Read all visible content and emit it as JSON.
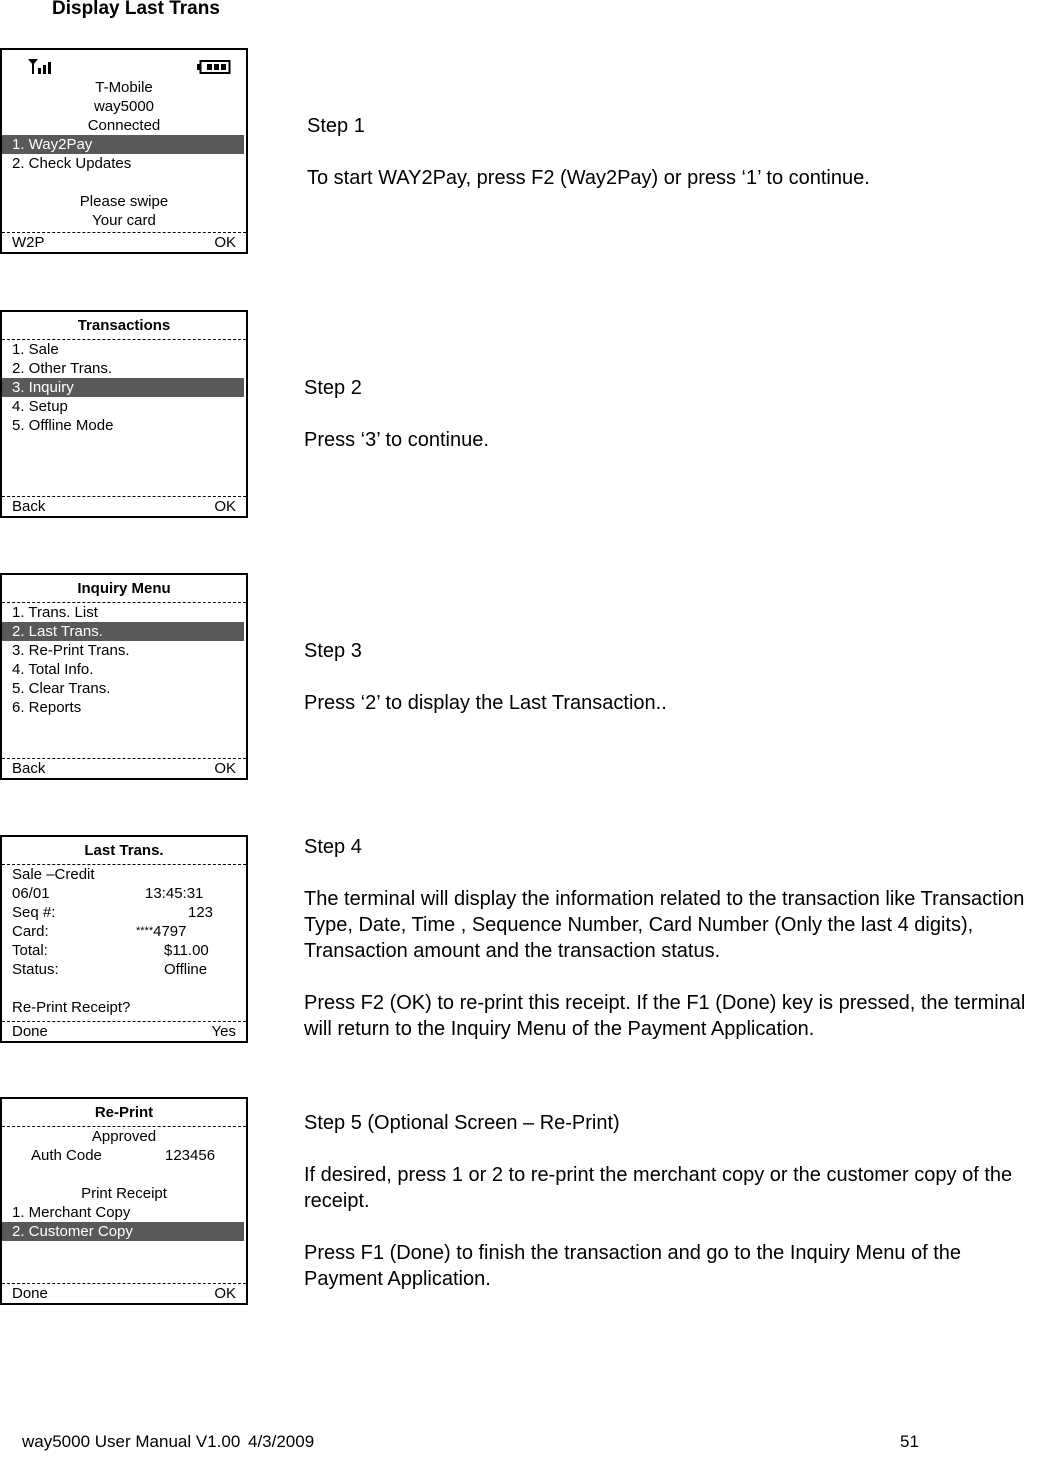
{
  "page_title": "Display Last Trans",
  "screens": {
    "s1": {
      "signal_icon": "signal-antenna-icon",
      "battery_icon": "battery-icon",
      "lines": [
        "T-Mobile",
        "way5000",
        "Connected"
      ],
      "menu": [
        "1. Way2Pay",
        "2. Check Updates"
      ],
      "selected_index": 0,
      "message": [
        "Please swipe",
        "Your card"
      ],
      "soft_left": "W2P",
      "soft_right": "OK"
    },
    "s2": {
      "header": "Transactions",
      "menu": [
        "1. Sale",
        "2. Other Trans.",
        "3. Inquiry",
        "4. Setup",
        "5. Offline Mode"
      ],
      "selected_index": 2,
      "soft_left": "Back",
      "soft_right": "OK"
    },
    "s3": {
      "header": "Inquiry Menu",
      "menu": [
        "1. Trans. List",
        "2. Last Trans.",
        "3. Re-Print Trans.",
        "4. Total Info.",
        "5. Clear Trans.",
        "6. Reports"
      ],
      "selected_index": 1,
      "soft_left": "Back",
      "soft_right": "OK"
    },
    "s4": {
      "header": "Last Trans.",
      "type": "Sale –Credit",
      "date": "06/01",
      "time": "13:45:31",
      "seq_label": "Seq #:",
      "seq_value": "123",
      "card_label": "Card:",
      "card_mask": "****",
      "card_value": "4797",
      "total_label": "Total:",
      "total_value": "$11.00",
      "status_label": "Status:",
      "status_value": "Offline",
      "prompt": "Re-Print Receipt?",
      "soft_left": "Done",
      "soft_right": "Yes"
    },
    "s5": {
      "header": "Re-Print",
      "status": "Approved",
      "auth_label": "Auth Code",
      "auth_value": "123456",
      "print_label": "Print Receipt",
      "menu": [
        "1. Merchant Copy",
        "2. Customer Copy"
      ],
      "selected_index": 1,
      "soft_left": "Done",
      "soft_right": "OK"
    }
  },
  "steps": [
    {
      "title": "Step 1",
      "paragraphs": [
        "To start WAY2Pay, press F2 (Way2Pay) or press ‘1’ to continue."
      ]
    },
    {
      "title": "Step 2",
      "paragraphs": [
        "Press ‘3’ to continue."
      ]
    },
    {
      "title": "Step 3",
      "paragraphs": [
        "Press ‘2’ to display the Last Transaction.."
      ]
    },
    {
      "title": "Step 4",
      "paragraphs": [
        "The terminal will display the information related to the transaction like Transaction Type, Date, Time , Sequence Number, Card Number (Only the last 4 digits), Transaction amount and the transaction status.",
        "Press F2 (OK) to re-print this receipt. If the F1 (Done) key is pressed, the terminal will return to the Inquiry Menu of the Payment Application."
      ]
    },
    {
      "title": "Step 5 (Optional Screen – Re-Print)",
      "paragraphs": [
        "If desired, press 1 or 2 to re-print the merchant copy or the customer copy of the receipt.",
        "Press F1 (Done) to finish the transaction and go to the Inquiry Menu of the Payment Application."
      ]
    }
  ],
  "footer": {
    "doc": "way5000 User Manual V1.00",
    "date": "4/3/2009",
    "page": "51"
  }
}
